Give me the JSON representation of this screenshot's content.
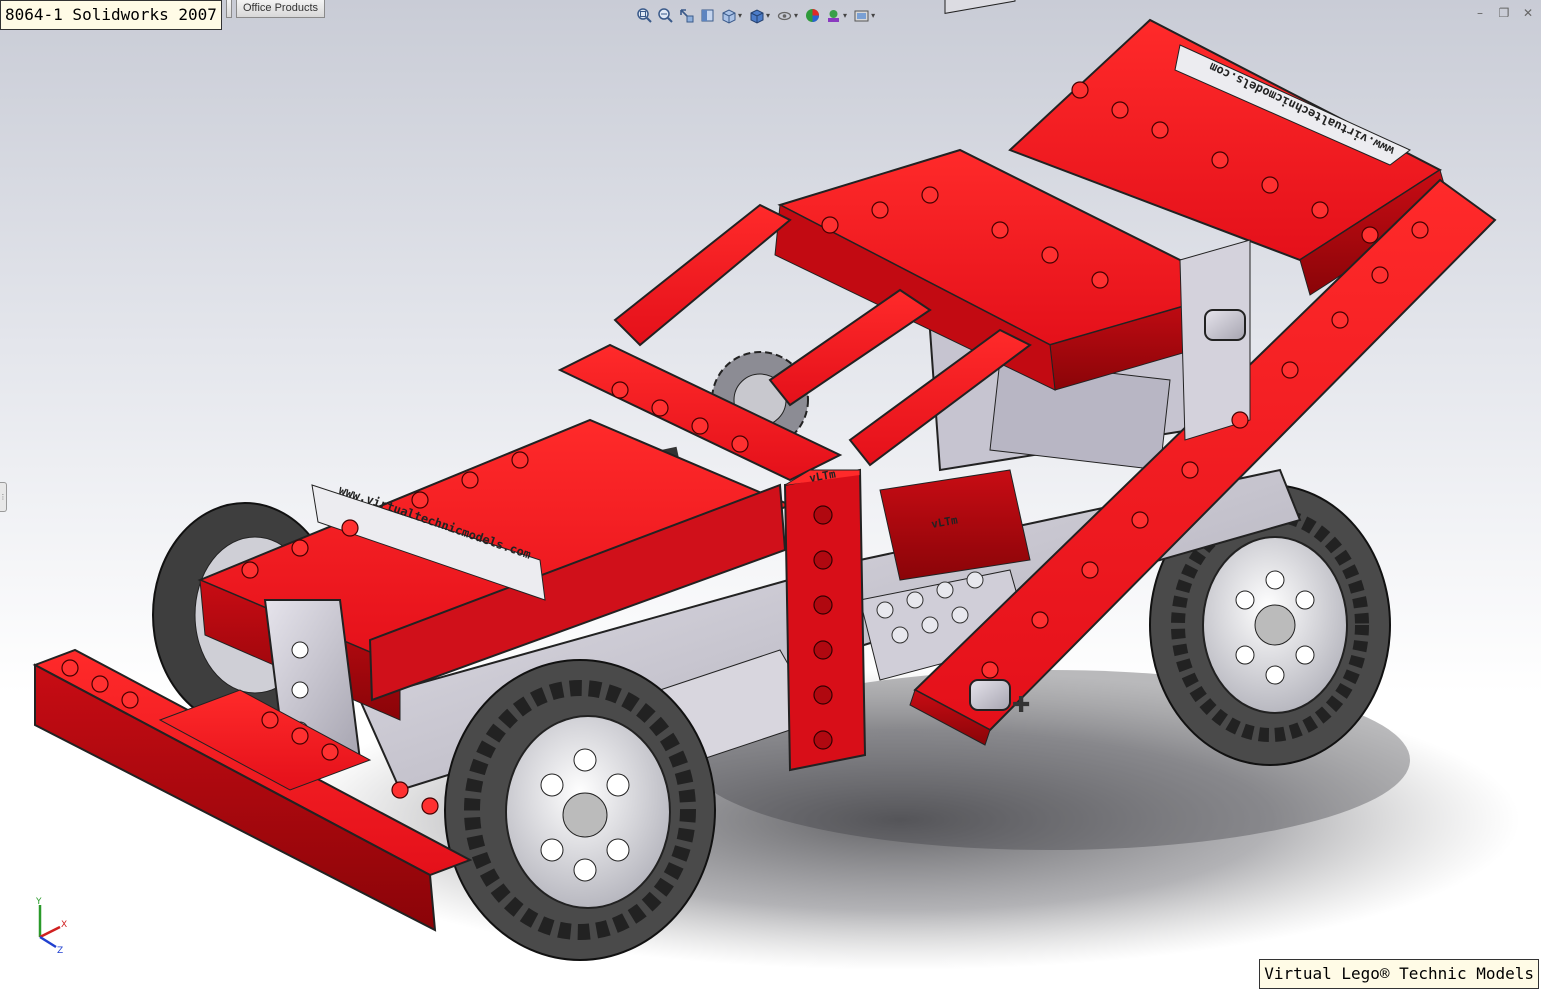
{
  "window": {
    "title": "8064-1 Solidworks 2007"
  },
  "tabs": [
    {
      "label": ""
    },
    {
      "label": "Office Products"
    }
  ],
  "view_toolbar": {
    "buttons": [
      {
        "icon": "zoom-to-fit-icon"
      },
      {
        "icon": "zoom-to-area-icon"
      },
      {
        "icon": "previous-view-icon"
      },
      {
        "icon": "section-view-icon"
      },
      {
        "icon": "view-orientation-icon",
        "dropdown": true
      },
      {
        "icon": "display-style-icon",
        "dropdown": true
      },
      {
        "icon": "hide-show-items-icon",
        "dropdown": true
      },
      {
        "icon": "edit-appearance-icon"
      },
      {
        "icon": "apply-scene-icon",
        "dropdown": true
      },
      {
        "icon": "view-settings-icon",
        "dropdown": true
      }
    ]
  },
  "window_controls": {
    "minimize": "–",
    "restore": "❐",
    "close": "✕"
  },
  "model": {
    "label_front": "www.virtualtechnicmodels.com",
    "label_rear": "www.virtualtechnicmodels.com",
    "logo_a": "vLTm",
    "logo_b": "vLTm",
    "colors": {
      "brick_red": "#e8141c",
      "brick_dark": "#a8060c",
      "gray_part": "#c8c6d0",
      "tire": "#4a4a4a"
    }
  },
  "triad": {
    "x": "X",
    "y": "Y",
    "z": "Z"
  },
  "watermark": "Virtual Lego® Technic Models"
}
